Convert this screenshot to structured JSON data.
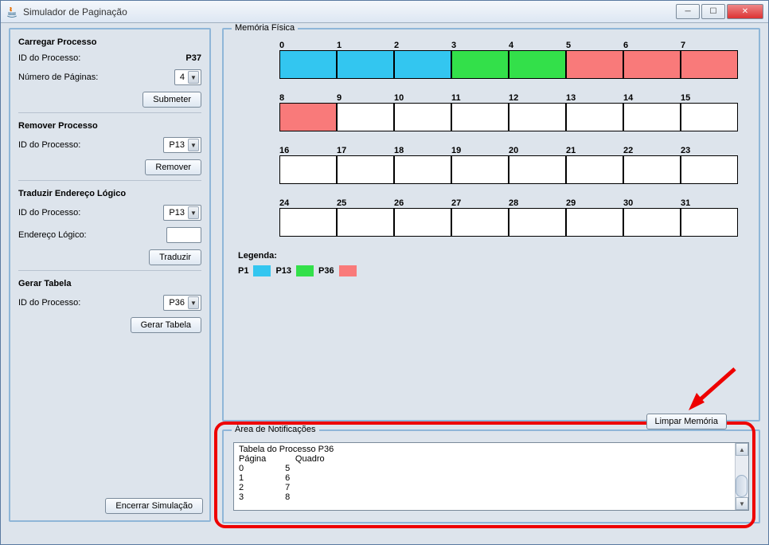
{
  "window": {
    "title": "Simulador de Paginação"
  },
  "load": {
    "title": "Carregar Processo",
    "idLabel": "ID do Processo:",
    "idValue": "P37",
    "pagesLabel": "Número de Páginas:",
    "pagesValue": "4",
    "submit": "Submeter"
  },
  "remove": {
    "title": "Remover Processo",
    "idLabel": "ID do Processo:",
    "idValue": "P13",
    "button": "Remover"
  },
  "translate": {
    "title": "Traduzir Endereço Lógico",
    "idLabel": "ID do Processo:",
    "idValue": "P13",
    "addrLabel": "Endereço Lógico:",
    "addrValue": "",
    "button": "Traduzir"
  },
  "table": {
    "title": "Gerar Tabela",
    "idLabel": "ID do Processo:",
    "idValue": "P36",
    "button": "Gerar Tabela"
  },
  "endButton": "Encerrar Simulação",
  "memory": {
    "title": "Memória Física",
    "clearButton": "Limpar Memória",
    "legendTitle": "Legenda:",
    "legend": [
      "P1",
      "P13",
      "P36"
    ],
    "rows": [
      {
        "labels": [
          "0",
          "1",
          "2",
          "3",
          "4",
          "5",
          "6",
          "7"
        ],
        "owners": [
          "p1",
          "p1",
          "p1",
          "p13",
          "p13",
          "p36",
          "p36",
          "p36"
        ]
      },
      {
        "labels": [
          "8",
          "9",
          "10",
          "11",
          "12",
          "13",
          "14",
          "15"
        ],
        "owners": [
          "p36",
          "",
          "",
          "",
          "",
          "",
          "",
          ""
        ]
      },
      {
        "labels": [
          "16",
          "17",
          "18",
          "19",
          "20",
          "21",
          "22",
          "23"
        ],
        "owners": [
          "",
          "",
          "",
          "",
          "",
          "",
          "",
          ""
        ]
      },
      {
        "labels": [
          "24",
          "25",
          "26",
          "27",
          "28",
          "29",
          "30",
          "31"
        ],
        "owners": [
          "",
          "",
          "",
          "",
          "",
          "",
          "",
          ""
        ]
      }
    ]
  },
  "notif": {
    "title": "Área de Notificações",
    "header": "Tabela do Processo P36",
    "col1": "Página",
    "col2": "Quadro",
    "rows": [
      {
        "p": "0",
        "q": "5"
      },
      {
        "p": "1",
        "q": "6"
      },
      {
        "p": "2",
        "q": "7"
      },
      {
        "p": "3",
        "q": "8"
      }
    ]
  }
}
